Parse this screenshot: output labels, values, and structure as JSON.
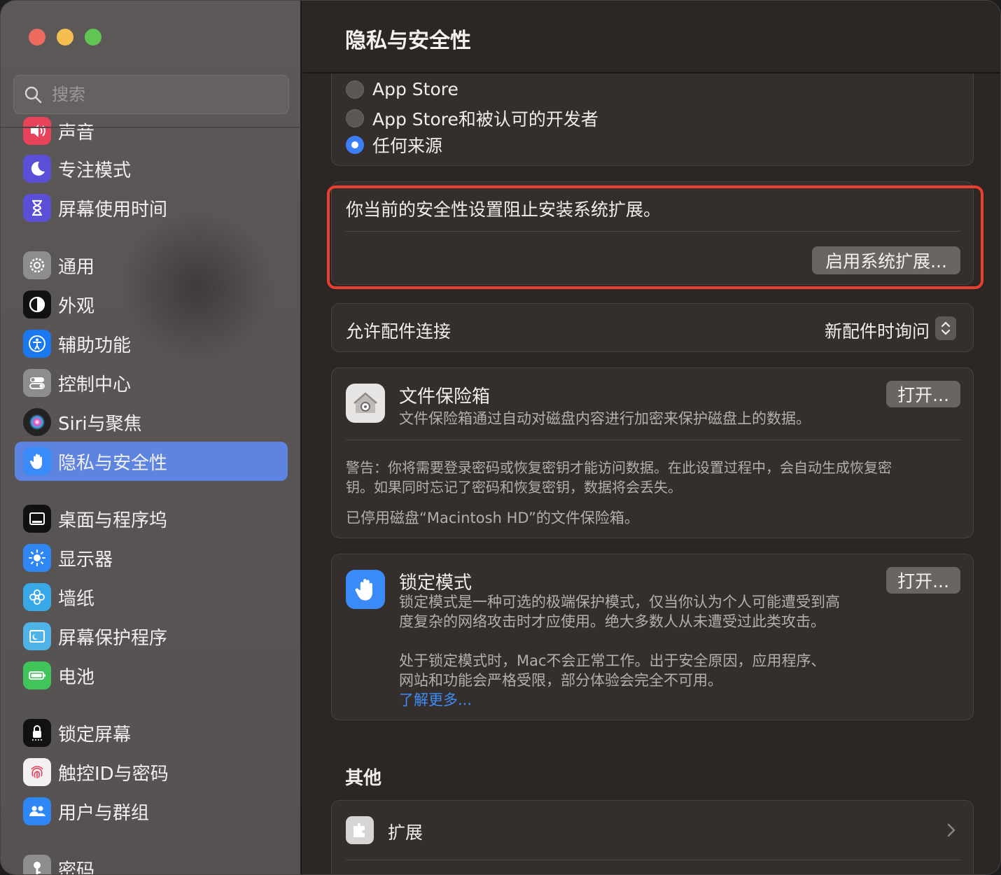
{
  "search": {
    "placeholder": "搜索"
  },
  "sidebar": {
    "items": [
      {
        "label": "声音",
        "color": "#e8435a"
      },
      {
        "label": "专注模式",
        "color": "#5a4fd6"
      },
      {
        "label": "屏幕使用时间",
        "color": "#5a4fd6"
      },
      {
        "label": "通用",
        "color": "#8d8d8d"
      },
      {
        "label": "外观",
        "color": "#111111"
      },
      {
        "label": "辅助功能",
        "color": "#1a78f0"
      },
      {
        "label": "控制中心",
        "color": "#8d8d8d"
      },
      {
        "label": "Siri与聚焦",
        "color": "#222222"
      },
      {
        "label": "隐私与安全性",
        "color": "#3a8bf7"
      },
      {
        "label": "桌面与程序坞",
        "color": "#111111"
      },
      {
        "label": "显示器",
        "color": "#2f86f5"
      },
      {
        "label": "墙纸",
        "color": "#39a8e6"
      },
      {
        "label": "屏幕保护程序",
        "color": "#4fb3e8"
      },
      {
        "label": "电池",
        "color": "#3fc55a"
      },
      {
        "label": "锁定屏幕",
        "color": "#111111"
      },
      {
        "label": "触控ID与密码",
        "color": "#f2f0f0"
      },
      {
        "label": "用户与群组",
        "color": "#2f86f5"
      },
      {
        "label": "密码",
        "color": "#8d8d8d"
      }
    ],
    "active_index": 8
  },
  "main": {
    "title": "隐私与安全性",
    "sources": {
      "options": [
        "App Store",
        "App Store和被认可的开发者",
        "任何来源"
      ],
      "selected_index": 2
    },
    "system_extension": {
      "message": "你当前的安全性设置阻止安装系统扩展。",
      "button": "启用系统扩展..."
    },
    "accessories": {
      "label": "允许配件连接",
      "value": "新配件时询问"
    },
    "filevault": {
      "title": "文件保险箱",
      "description": "文件保险箱通过自动对磁盘内容进行加密来保护磁盘上的数据。",
      "button": "打开...",
      "warning_line1": "警告：你将需要登录密码或恢复密钥才能访问数据。在此设置过程中，会自动生成恢复密",
      "warning_line2": "钥。如果同时忘记了密码和恢复密钥，数据将会丢失。",
      "status": "已停用磁盘“Macintosh HD”的文件保险箱。"
    },
    "lockdown": {
      "title": "锁定模式",
      "desc_line1": "锁定模式是一种可选的极端保护模式，仅当你认为个人可能遭受到高",
      "desc_line2": "度复杂的网络攻击时才应使用。绝大多数人从未遭受过此类攻击。",
      "desc_line3": "处于锁定模式时，Mac不会正常工作。出于安全原因，应用程序、",
      "desc_line4": "网站和功能会严格受限，部分体验会完全不可用。",
      "link": "了解更多...",
      "button": "打开..."
    },
    "others": {
      "heading": "其他",
      "extensions_label": "扩展"
    }
  }
}
